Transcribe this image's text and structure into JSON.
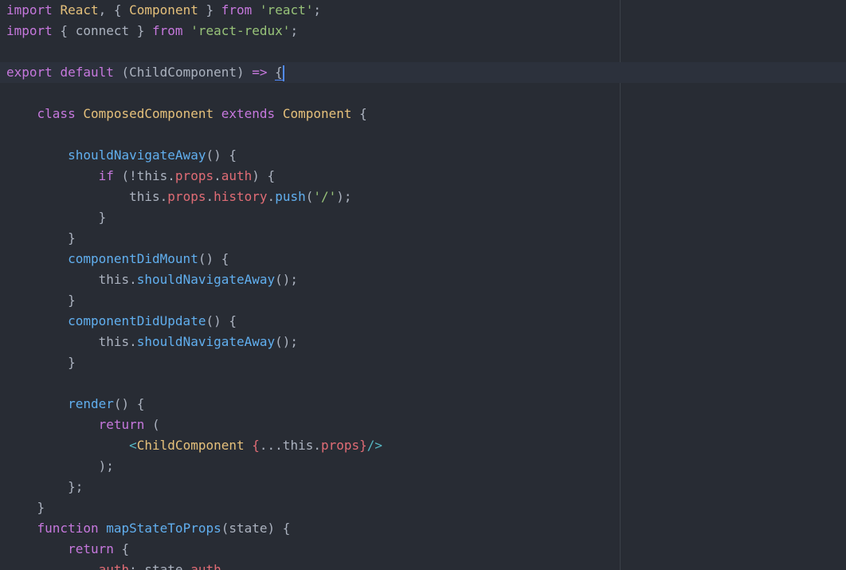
{
  "colors": {
    "background": "#282c34",
    "active_line": "#2c313c",
    "ruler": "#3b4048",
    "cursor": "#528bff",
    "keyword": "#c678dd",
    "type": "#e5c07b",
    "string": "#98c379",
    "function": "#61afef",
    "property": "#e06c75",
    "plain": "#abb2bf",
    "operator": "#56b6c2"
  },
  "editor": {
    "active_line_index": 3,
    "lines": [
      [
        [
          "k",
          "import"
        ],
        [
          "p",
          " "
        ],
        [
          "t",
          "React"
        ],
        [
          "p",
          ", { "
        ],
        [
          "t",
          "Component"
        ],
        [
          "p",
          " } "
        ],
        [
          "k",
          "from"
        ],
        [
          "p",
          " "
        ],
        [
          "s",
          "'react'"
        ],
        [
          "p",
          ";"
        ]
      ],
      [
        [
          "k",
          "import"
        ],
        [
          "p",
          " { connect } "
        ],
        [
          "k",
          "from"
        ],
        [
          "p",
          " "
        ],
        [
          "s",
          "'react-redux'"
        ],
        [
          "p",
          ";"
        ]
      ],
      [],
      [
        [
          "k",
          "export"
        ],
        [
          "p",
          " "
        ],
        [
          "k",
          "default"
        ],
        [
          "p",
          " (ChildComponent) "
        ],
        [
          "k",
          "=>"
        ],
        [
          "p",
          " "
        ],
        [
          "b",
          "{"
        ],
        [
          "c",
          ""
        ]
      ],
      [],
      [
        [
          "p",
          "    "
        ],
        [
          "k",
          "class"
        ],
        [
          "p",
          " "
        ],
        [
          "t",
          "ComposedComponent"
        ],
        [
          "p",
          " "
        ],
        [
          "k",
          "extends"
        ],
        [
          "p",
          " "
        ],
        [
          "t",
          "Component"
        ],
        [
          "p",
          " {"
        ]
      ],
      [],
      [
        [
          "p",
          "        "
        ],
        [
          "f",
          "shouldNavigateAway"
        ],
        [
          "p",
          "() {"
        ]
      ],
      [
        [
          "p",
          "            "
        ],
        [
          "k",
          "if"
        ],
        [
          "p",
          " (!this."
        ],
        [
          "r",
          "props"
        ],
        [
          "p",
          "."
        ],
        [
          "r",
          "auth"
        ],
        [
          "p",
          ") {"
        ]
      ],
      [
        [
          "p",
          "                this."
        ],
        [
          "r",
          "props"
        ],
        [
          "p",
          "."
        ],
        [
          "r",
          "history"
        ],
        [
          "p",
          "."
        ],
        [
          "f",
          "push"
        ],
        [
          "p",
          "("
        ],
        [
          "s",
          "'/'"
        ],
        [
          "p",
          ");"
        ]
      ],
      [
        [
          "p",
          "            }"
        ]
      ],
      [
        [
          "p",
          "        }"
        ]
      ],
      [
        [
          "p",
          "        "
        ],
        [
          "f",
          "componentDidMount"
        ],
        [
          "p",
          "() {"
        ]
      ],
      [
        [
          "p",
          "            this."
        ],
        [
          "f",
          "shouldNavigateAway"
        ],
        [
          "p",
          "();"
        ]
      ],
      [
        [
          "p",
          "        }"
        ]
      ],
      [
        [
          "p",
          "        "
        ],
        [
          "f",
          "componentDidUpdate"
        ],
        [
          "p",
          "() {"
        ]
      ],
      [
        [
          "p",
          "            this."
        ],
        [
          "f",
          "shouldNavigateAway"
        ],
        [
          "p",
          "();"
        ]
      ],
      [
        [
          "p",
          "        }"
        ]
      ],
      [],
      [
        [
          "p",
          "        "
        ],
        [
          "f",
          "render"
        ],
        [
          "p",
          "() {"
        ]
      ],
      [
        [
          "p",
          "            "
        ],
        [
          "k",
          "return"
        ],
        [
          "p",
          " ("
        ]
      ],
      [
        [
          "p",
          "                "
        ],
        [
          "o",
          "<"
        ],
        [
          "t",
          "ChildComponent"
        ],
        [
          "p",
          " "
        ],
        [
          "r",
          "{"
        ],
        [
          "p",
          "...this."
        ],
        [
          "r",
          "props"
        ],
        [
          "r",
          "}"
        ],
        [
          "o",
          "/>"
        ]
      ],
      [
        [
          "p",
          "            );"
        ]
      ],
      [
        [
          "p",
          "        };"
        ]
      ],
      [
        [
          "p",
          "    }"
        ]
      ],
      [
        [
          "p",
          "    "
        ],
        [
          "k",
          "function"
        ],
        [
          "p",
          " "
        ],
        [
          "f",
          "mapStateToProps"
        ],
        [
          "p",
          "(state) {"
        ]
      ],
      [
        [
          "p",
          "        "
        ],
        [
          "k",
          "return"
        ],
        [
          "p",
          " {"
        ]
      ],
      [
        [
          "p",
          "            "
        ],
        [
          "r",
          "auth"
        ],
        [
          "p",
          ": state."
        ],
        [
          "r",
          "auth"
        ]
      ]
    ]
  }
}
